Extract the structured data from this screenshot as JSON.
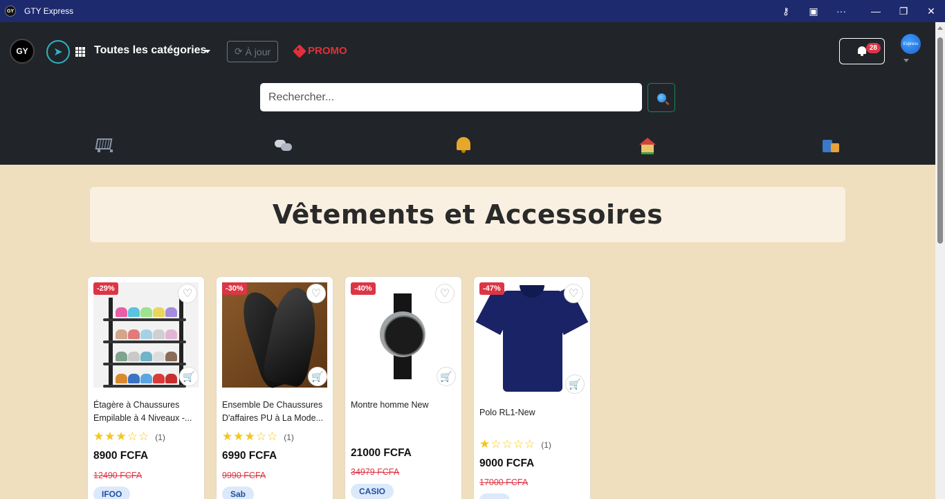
{
  "window": {
    "title": "GTY Express",
    "icon_label": "GY"
  },
  "header": {
    "logo_text": "GY",
    "categories_label": "Toutes les catégories",
    "update_button_label": "À jour",
    "promo_label": "PROMO",
    "notification_count": "28",
    "avatar_label": "Express"
  },
  "search": {
    "placeholder": "Rechercher..."
  },
  "nav_icons": [
    "cart-icon",
    "chat-icon",
    "bell-icon",
    "house-icon",
    "shopping-bags-icon"
  ],
  "section": {
    "title": "Vêtements et Accessoires"
  },
  "products": [
    {
      "discount": "-29%",
      "name": "Étagère à Chaussures Empilable à 4 Niveaux -...",
      "rating": 3,
      "rating_count": "(1)",
      "price": "8900 FCFA",
      "old_price": "12490 FCFA",
      "brand": "IFOO"
    },
    {
      "discount": "-30%",
      "name": "Ensemble De Chaussures D'affaires PU à La Mode...",
      "rating": 3,
      "rating_count": "(1)",
      "price": "6990 FCFA",
      "old_price": "9990 FCFA",
      "brand": "Sab"
    },
    {
      "discount": "-40%",
      "name": "Montre homme New",
      "rating": null,
      "rating_count": "",
      "price": "21000 FCFA",
      "old_price": "34979 FCFA",
      "brand": "CASIO"
    },
    {
      "discount": "-47%",
      "name": "Polo RL1-New",
      "rating": 1,
      "rating_count": "(1)",
      "price": "9000 FCFA",
      "old_price": "17000 FCFA",
      "brand": ""
    }
  ],
  "colors": {
    "header_bg": "#212529",
    "titlebar_bg": "#1e2a6e",
    "page_bg": "#efdfbe",
    "discount": "#dc3545",
    "promo": "#e0313b"
  }
}
